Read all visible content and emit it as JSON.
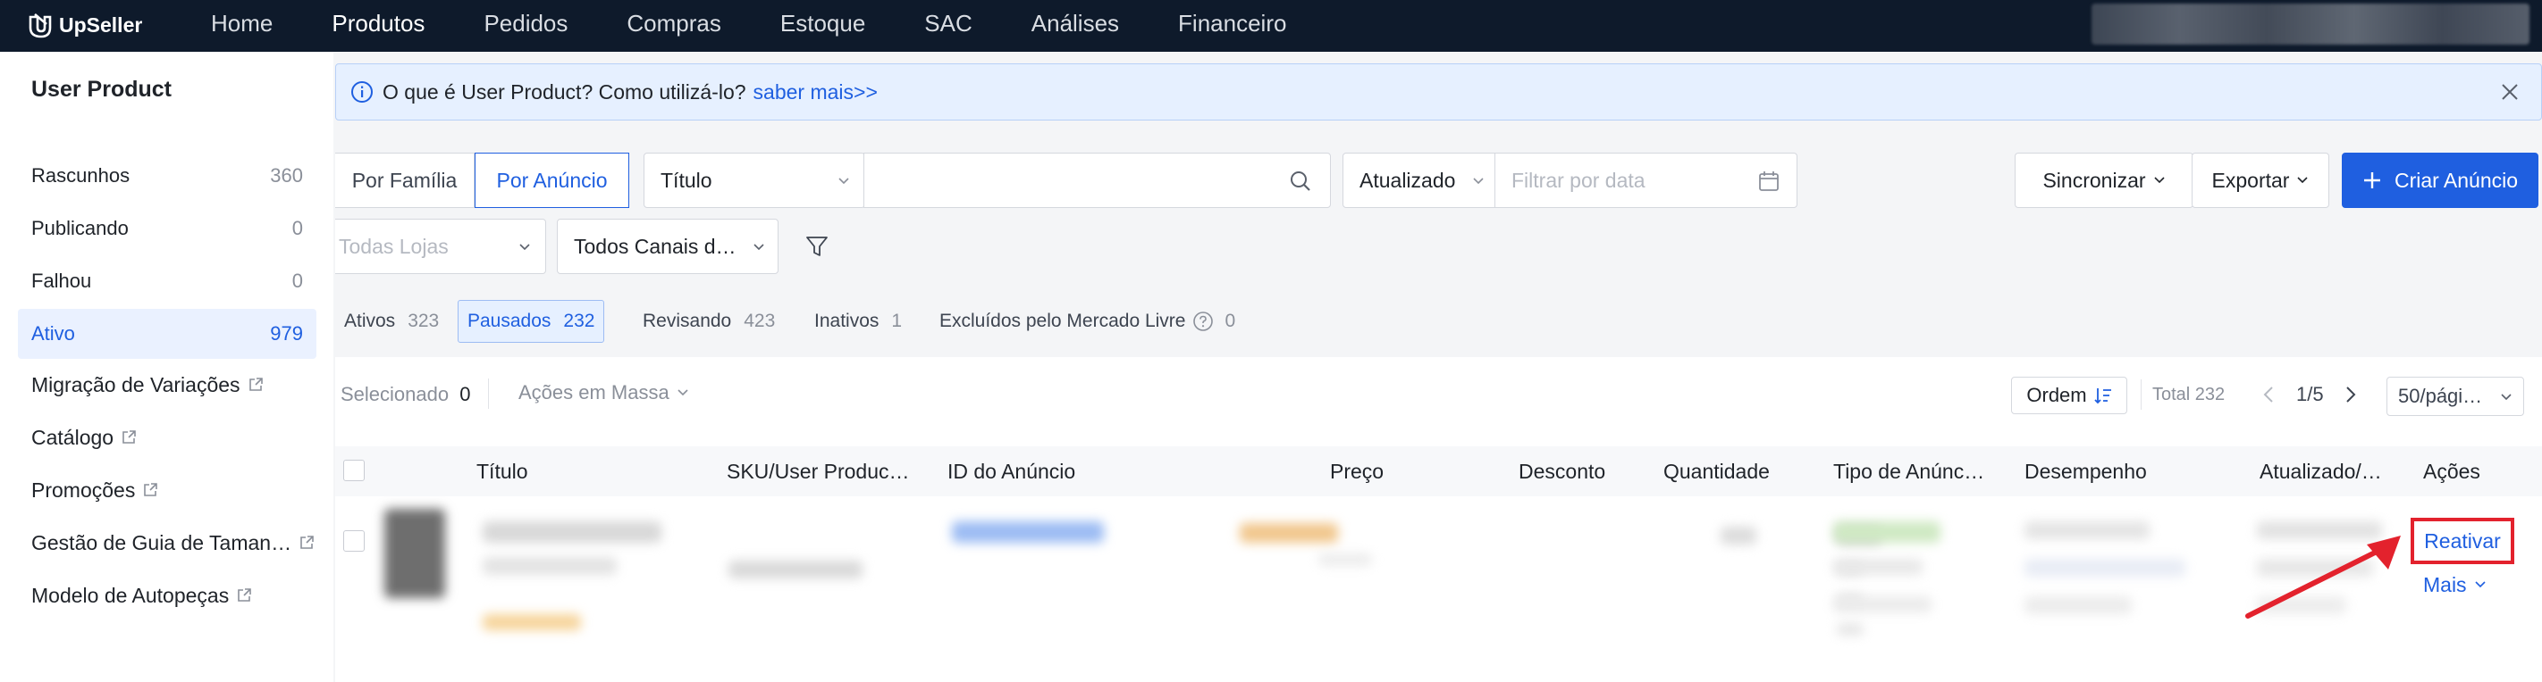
{
  "topnav": {
    "brand": "UpSeller",
    "links": [
      "Home",
      "Produtos",
      "Pedidos",
      "Compras",
      "Estoque",
      "SAC",
      "Análises",
      "Financeiro"
    ],
    "active": "Produtos"
  },
  "sidebar": {
    "title": "User Product",
    "items": [
      {
        "label": "Rascunhos",
        "count": "360"
      },
      {
        "label": "Publicando",
        "count": "0"
      },
      {
        "label": "Falhou",
        "count": "0"
      },
      {
        "label": "Ativo",
        "count": "979"
      }
    ],
    "links": [
      "Migração de Variações",
      "Catálogo",
      "Promoções",
      "Gestão de Guia de Taman…",
      "Modelo de Autopeças"
    ]
  },
  "banner": {
    "text": "O que é User Product? Como utilizá-lo?",
    "link": "saber mais>>"
  },
  "filters": {
    "by_family": "Por Família",
    "by_listing": "Por Anúncio",
    "title_select": "Título",
    "updated_select": "Atualizado",
    "date_placeholder": "Filtrar por data",
    "stores_placeholder": "Todas Lojas",
    "channels": "Todos Canais d…"
  },
  "actions": {
    "sync": "Sincronizar",
    "export": "Exportar",
    "create": "Criar Anúncio"
  },
  "status_tabs": [
    {
      "label": "Ativos",
      "count": "323"
    },
    {
      "label": "Pausados",
      "count": "232"
    },
    {
      "label": "Revisando",
      "count": "423"
    },
    {
      "label": "Inativos",
      "count": "1"
    },
    {
      "label": "Excluídos pelo Mercado Livre",
      "count": "0"
    }
  ],
  "table_toolbar": {
    "selected_label": "Selecionado",
    "selected_count": "0",
    "bulk_actions": "Ações em Massa",
    "order": "Ordem",
    "total": "Total 232",
    "page": "1/5",
    "page_size": "50/pági…"
  },
  "columns": [
    "Título",
    "SKU/User Produc…",
    "ID do Anúncio",
    "Preço",
    "Desconto",
    "Quantidade",
    "Tipo de Anúnc…",
    "Desempenho",
    "Atualizado/…",
    "Ações"
  ],
  "row_actions": {
    "reactivate": "Reativar",
    "more": "Mais"
  },
  "colors": {
    "nav_bg": "#0e1a2b",
    "accent": "#1f5fe0",
    "highlight": "#e3222d"
  }
}
